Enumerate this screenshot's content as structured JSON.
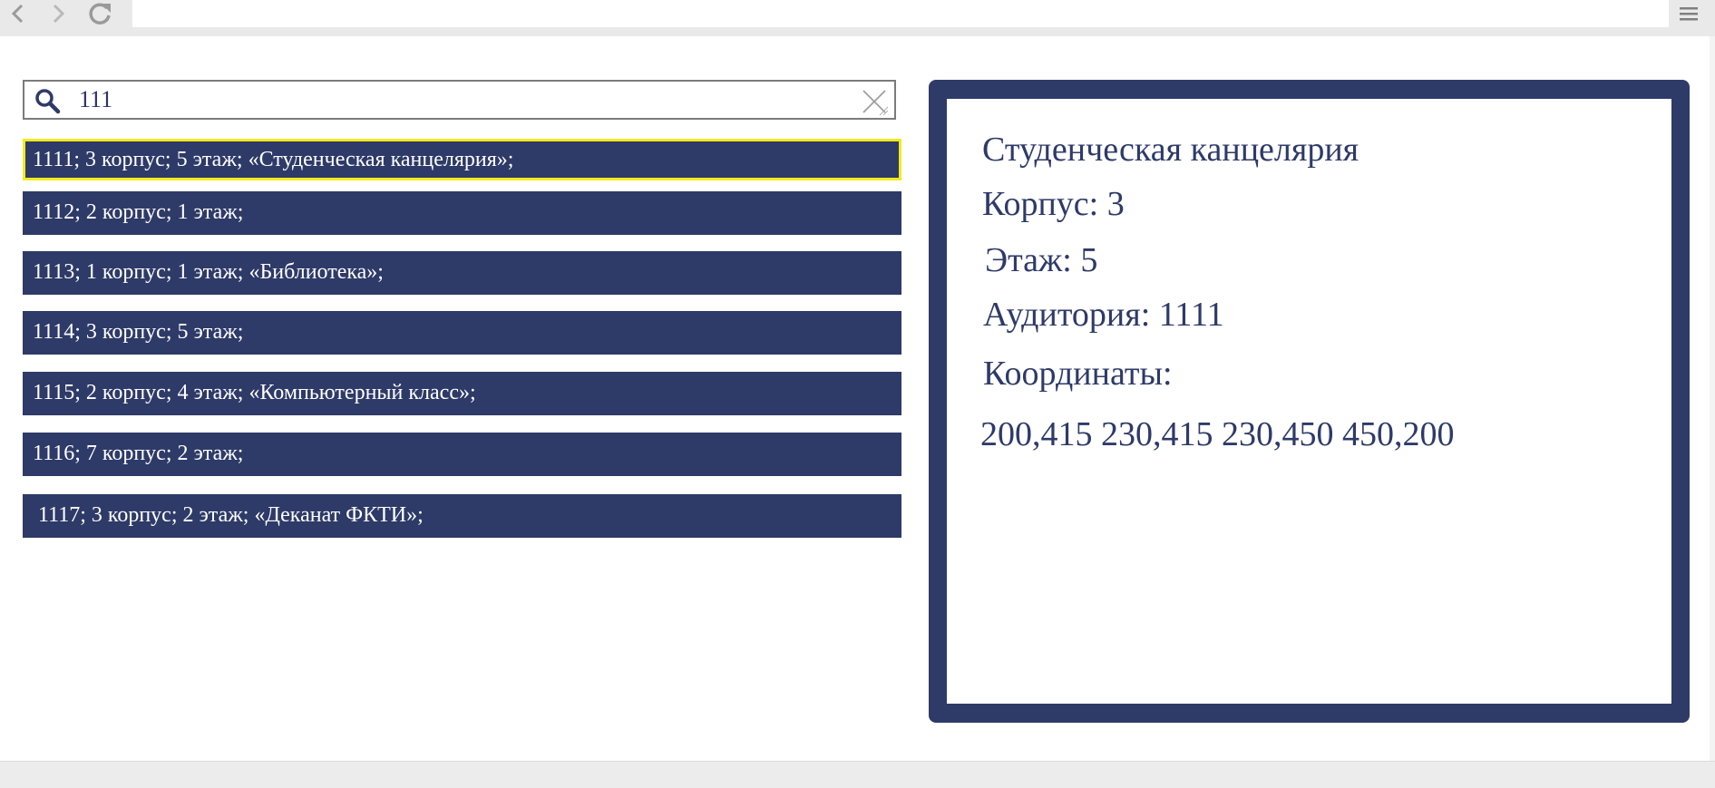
{
  "browser": {
    "back_icon": "chevron-left-icon",
    "forward_icon": "chevron-right-icon",
    "reload_icon": "reload-icon",
    "menu_icon": "hamburger-menu-icon",
    "address": ""
  },
  "search": {
    "icon": "search-icon",
    "value": "111",
    "placeholder": "",
    "clear_icon": "close-icon"
  },
  "results": [
    {
      "label": "1111; 3 корпус; 5 этаж; «Студенческая канцелярия»;",
      "selected": true
    },
    {
      "label": "1112; 2 корпус; 1 этаж;",
      "selected": false
    },
    {
      "label": "1113; 1 корпус; 1 этаж; «Библиотека»;",
      "selected": false
    },
    {
      "label": "1114; 3 корпус; 5 этаж;",
      "selected": false
    },
    {
      "label": "1115; 2 корпус; 4 этаж; «Компьютерный класс»;",
      "selected": false
    },
    {
      "label": "1116; 7 корпус; 2 этаж;",
      "selected": false
    },
    {
      "label": " 1117; 3 корпус; 2 этаж; «Деканат ФКТИ»;",
      "selected": false
    }
  ],
  "detail": {
    "title": "Студенческая канцелярия",
    "building": "Корпус: 3",
    "floor": "Этаж: 5",
    "room": "Аудитория: 1111",
    "coords_label": "Координаты:",
    "coords_value": "200,415 230,415 230,450 450,200"
  },
  "colors": {
    "accent": "#2e3a68",
    "highlight": "#f2ea1e",
    "chrome": "#e9e9e9"
  }
}
